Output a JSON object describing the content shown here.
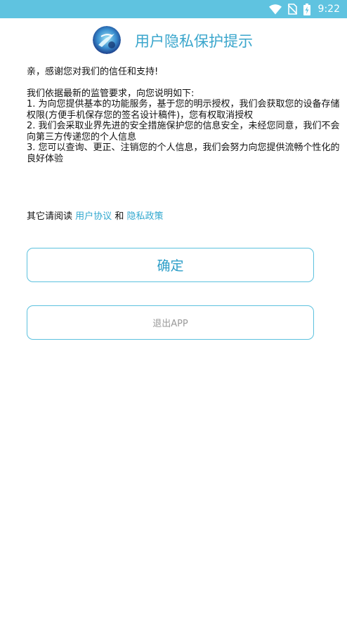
{
  "status_bar": {
    "time": "9:22",
    "icons": [
      "wifi-icon",
      "no-sim-icon",
      "battery-charging-icon"
    ],
    "background": "#5fc3e0"
  },
  "header": {
    "title": "用户隐私保护提示",
    "logo_icon": "app-logo-icon",
    "title_color": "#3aa6cc"
  },
  "body": {
    "greeting": "亲，感谢您对我们的信任和支持!",
    "intro": "我们依据最新的监管要求，向您说明如下:",
    "items": [
      "1. 为向您提供基本的功能服务，基于您的明示授权，我们会获取您的设备存储权限(方便手机保存您的签名设计稿件)，您有权取消授权",
      "2. 我们会采取业界先进的安全措施保护您的信息安全，未经您同意，我们不会向第三方传递您的个人信息",
      "3. 您可以查询、更正、注销您的个人信息，我们会努力向您提供流畅个性化的良好体验"
    ]
  },
  "policy": {
    "prefix": "其它请阅读",
    "user_agreement": "用户协议",
    "conjunction": "和",
    "privacy_policy": "隐私政策",
    "link_color": "#31a8cf"
  },
  "buttons": {
    "confirm": "确定",
    "exit": "退出APP",
    "border_color": "#5cc1de"
  }
}
